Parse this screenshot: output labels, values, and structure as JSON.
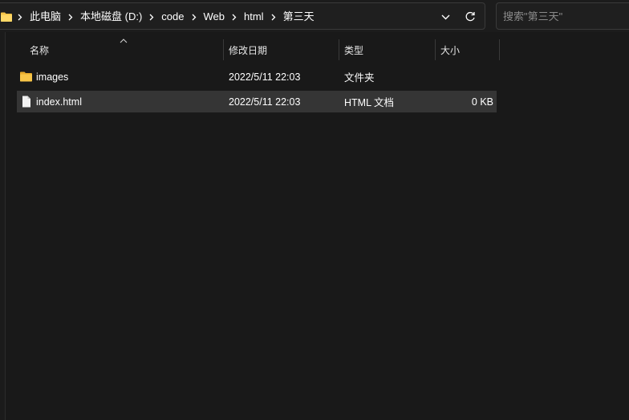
{
  "breadcrumb": {
    "items": [
      {
        "label": "此电脑"
      },
      {
        "label": "本地磁盘 (D:)"
      },
      {
        "label": "code"
      },
      {
        "label": "Web"
      },
      {
        "label": "html"
      },
      {
        "label": "第三天"
      }
    ]
  },
  "search": {
    "placeholder": "搜索\"第三天\""
  },
  "columns": {
    "name": "名称",
    "modified": "修改日期",
    "type": "类型",
    "size": "大小"
  },
  "files": [
    {
      "name": "images",
      "modified": "2022/5/11 22:03",
      "type": "文件夹",
      "size": "",
      "icon": "folder-icon"
    },
    {
      "name": "index.html",
      "modified": "2022/5/11 22:03",
      "type": "HTML 文档",
      "size": "0 KB",
      "icon": "file-icon",
      "selected": true
    }
  ],
  "colors": {
    "background": "#191919",
    "selected_row": "#353535",
    "folder_yellow": "#f7c548",
    "border": "#3a3a3a"
  }
}
